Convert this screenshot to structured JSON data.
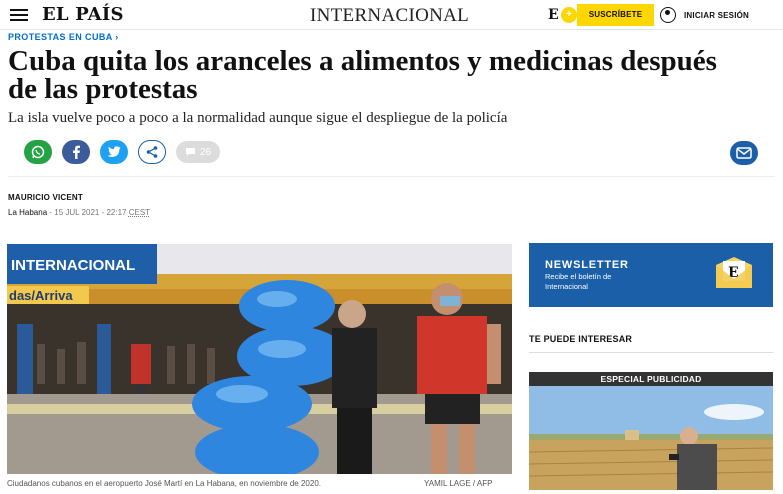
{
  "header": {
    "logo": "EL PAÍS",
    "section": "INTERNACIONAL",
    "ep_letter": "E",
    "subscribe_label": "SUSCRÍBETE",
    "login_label": "INICIAR SESIÓN"
  },
  "article": {
    "kicker": "PROTESTAS EN CUBA",
    "kicker_chevron": "›",
    "headline": "Cuba quita los aranceles a alimentos y medicinas después de las protestas",
    "subhead": "La isla vuelve poco a poco a la normalidad aunque sigue el despliegue de la policía",
    "comments_count": "26",
    "author": "MAURICIO VICENT",
    "location": "La Habana",
    "date": "15 JUL 2021 - 22:17",
    "timezone": "CEST",
    "photo_caption": "Ciudadanos cubanos en el aeropuerto José Martí en La Habana, en noviembre de 2020.",
    "photo_credit": "YAMIL LAGE / AFP",
    "photo_sign_text": "INTERNACIONAL",
    "photo_sign_text2": "das/Arriva"
  },
  "sidebar": {
    "newsletter_title": "NEWSLETTER",
    "newsletter_text": "Recibe el boletín de Internacional",
    "interest_title": "TE PUEDE INTERESAR",
    "promo_label": "ESPECIAL PUBLICIDAD"
  },
  "icons": [
    "menu-icon",
    "user-icon",
    "whatsapp-icon",
    "facebook-icon",
    "twitter-icon",
    "share-icon",
    "comment-icon",
    "mail-icon",
    "envelope-icon"
  ],
  "colors": {
    "accent_yellow": "#ffd700",
    "link_blue": "#006dd2",
    "newsletter_blue": "#1a5fa8",
    "whatsapp": "#25a244",
    "facebook": "#3b5b9a",
    "twitter": "#1da1f2"
  }
}
